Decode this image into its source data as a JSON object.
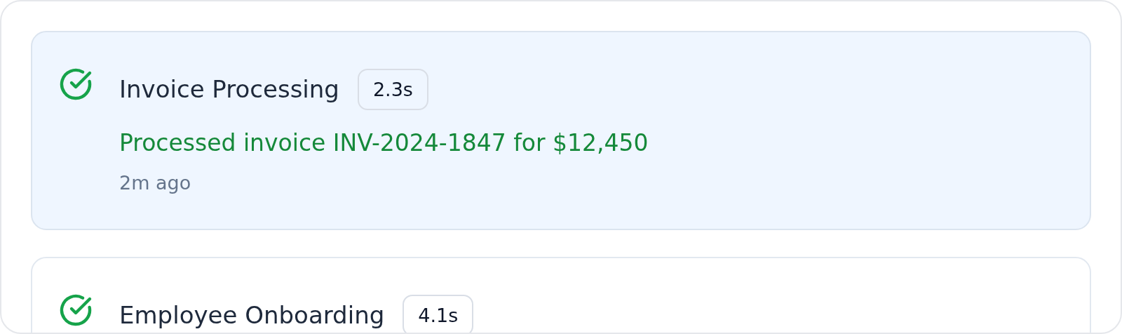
{
  "activities": [
    {
      "title": "Invoice Processing",
      "duration": "2.3s",
      "kind": "success",
      "selected": true,
      "message": "Processed invoice INV-2024-1847 for $12,450",
      "time": "2m ago"
    },
    {
      "title": "Employee Onboarding",
      "duration": "4.1s",
      "kind": "success",
      "selected": false
    }
  ]
}
